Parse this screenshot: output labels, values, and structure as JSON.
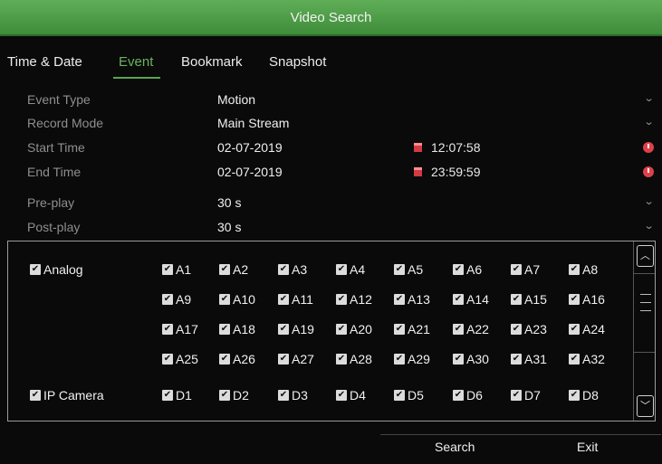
{
  "window": {
    "title": "Video Search"
  },
  "tabs": [
    {
      "label": "Time & Date"
    },
    {
      "label": "Event"
    },
    {
      "label": "Bookmark"
    },
    {
      "label": "Snapshot"
    }
  ],
  "active_tab": "Event",
  "form": {
    "event_type": {
      "label": "Event Type",
      "value": "Motion"
    },
    "record_mode": {
      "label": "Record Mode",
      "value": "Main Stream"
    },
    "start_time": {
      "label": "Start Time",
      "date": "02-07-2019",
      "time": "12:07:58"
    },
    "end_time": {
      "label": "End Time",
      "date": "02-07-2019",
      "time": "23:59:59"
    },
    "pre_play": {
      "label": "Pre-play",
      "value": "30 s"
    },
    "post_play": {
      "label": "Post-play",
      "value": "30 s"
    }
  },
  "channels": {
    "analog": {
      "label": "Analog",
      "checked": true,
      "items": [
        "A1",
        "A2",
        "A3",
        "A4",
        "A5",
        "A6",
        "A7",
        "A8",
        "A9",
        "A10",
        "A11",
        "A12",
        "A13",
        "A14",
        "A15",
        "A16",
        "A17",
        "A18",
        "A19",
        "A20",
        "A21",
        "A22",
        "A23",
        "A24",
        "A25",
        "A26",
        "A27",
        "A28",
        "A29",
        "A30",
        "A31",
        "A32"
      ]
    },
    "ip_camera": {
      "label": "IP Camera",
      "checked": true,
      "items": [
        "D1",
        "D2",
        "D3",
        "D4",
        "D5",
        "D6",
        "D7",
        "D8"
      ]
    }
  },
  "footer": {
    "search_label": "Search",
    "exit_label": "Exit"
  },
  "colors": {
    "title_bar": "#4d9e46",
    "active_tab": "#69b35f",
    "checkbox": "#dcdcdc",
    "time_icon": "#e0404a"
  }
}
